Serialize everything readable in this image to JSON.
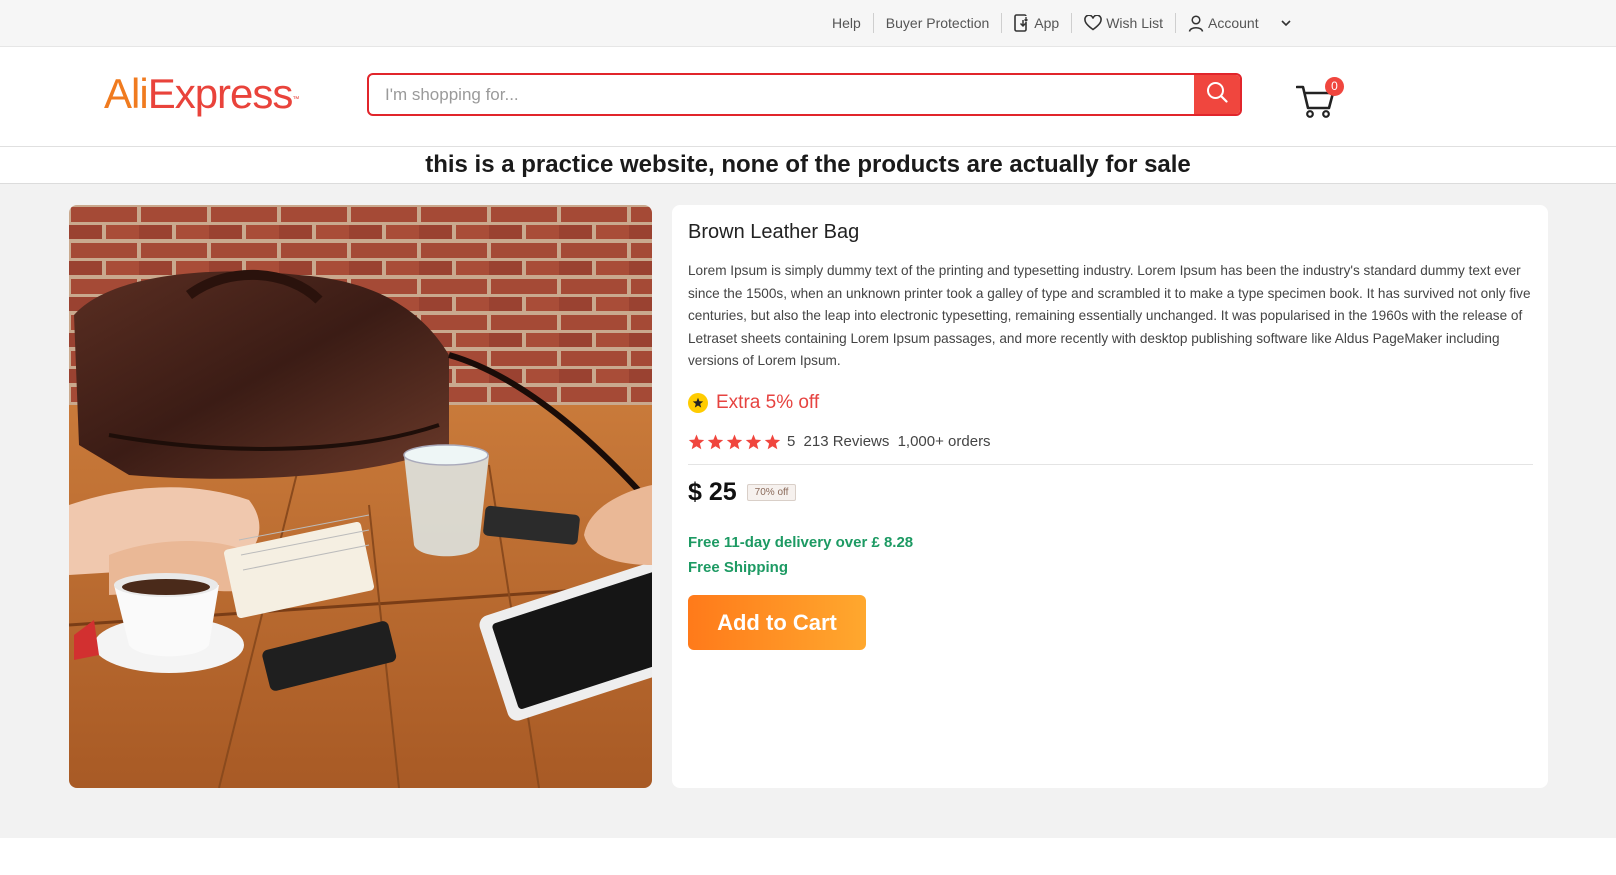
{
  "topbar": {
    "help": "Help",
    "buyer_protection": "Buyer Protection",
    "app": "App",
    "wish_list": "Wish List",
    "account": "Account"
  },
  "header": {
    "logo_ali": "Ali",
    "logo_express": "Express",
    "logo_tm": "™",
    "search_placeholder": "I'm shopping for...",
    "cart_count": "0"
  },
  "notice": "this is a practice website, none of the products are actually for sale",
  "product": {
    "title": "Brown Leather Bag",
    "description": "Lorem Ipsum is simply dummy text of the printing and typesetting industry. Lorem Ipsum has been the industry's standard dummy text ever since the 1500s, when an unknown printer took a galley of type and scrambled it to make a type specimen book. It has survived not only five centuries, but also the leap into electronic typesetting, remaining essentially unchanged. It was popularised in the 1960s with the release of Letraset sheets containing Lorem Ipsum passages, and more recently with desktop publishing software like Aldus PageMaker including versions of Lorem Ipsum.",
    "promo": "Extra 5% off",
    "rating_value": "5",
    "stars": 5,
    "reviews": "213 Reviews",
    "orders": "1,000+ orders",
    "price": "$ 25",
    "discount": "70% off",
    "delivery": "Free 11-day delivery over £ 8.28",
    "shipping": "Free Shipping",
    "add_to_cart": "Add to Cart"
  },
  "colors": {
    "accent_red": "#e1252b",
    "promo_red": "#e64340",
    "shipping_green": "#1d9a63",
    "cart_button_orange": "#ff8c1f"
  }
}
